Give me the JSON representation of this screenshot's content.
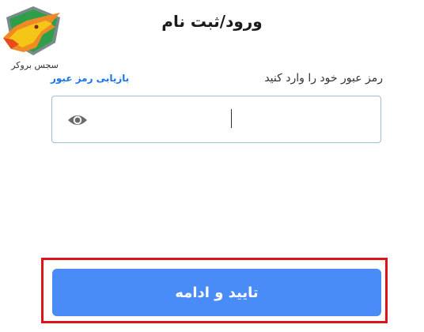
{
  "brand": {
    "logo_text": "سجس بروکر",
    "logo_colors": [
      "#f5c518",
      "#f08a24",
      "#e84a1f",
      "#2e9e4a",
      "#7a8a8a"
    ]
  },
  "header": {
    "title": "ورود/ثبت نام"
  },
  "password": {
    "label": "رمز عبور خود را وارد کنید",
    "forgot_link": "بازیابی رمز عبور",
    "value": "",
    "placeholder": "",
    "toggle_icon": "eye-icon"
  },
  "submit": {
    "label": "تایید و ادامه",
    "color": "#4a8cf7",
    "highlight_color": "#e0121a"
  }
}
